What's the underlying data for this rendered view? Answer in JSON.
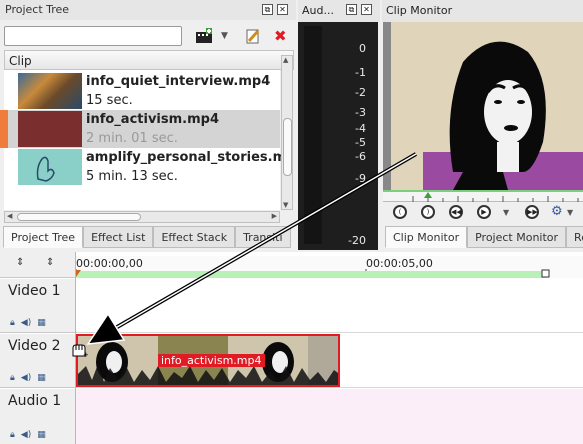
{
  "project_tree": {
    "title": "Project Tree",
    "column_header": "Clip",
    "clips": [
      {
        "name": "info_quiet_interview.mp4",
        "duration": "15 sec."
      },
      {
        "name": "info_activism.mp4",
        "duration": "2 min. 01 sec."
      },
      {
        "name": "amplify_personal_stories.m",
        "duration": "5 min. 13 sec."
      }
    ],
    "tabs": [
      "Project Tree",
      "Effect List",
      "Effect Stack",
      "Transiti"
    ]
  },
  "audio_meter": {
    "title": "Aud...",
    "ticks": [
      "0",
      "-1",
      "-2",
      "-3",
      "-4",
      "-5",
      "-6",
      "-9",
      "-20"
    ]
  },
  "clip_monitor": {
    "title": "Clip Monitor",
    "tabs": [
      "Clip Monitor",
      "Project Monitor",
      "Re"
    ]
  },
  "timeline": {
    "timecodes": [
      "00:00:00,00",
      "00:00:05,00"
    ],
    "tracks": [
      "Video 1",
      "Video 2",
      "Audio 1"
    ],
    "clip_label": "info_activism.mp4"
  },
  "colors": {
    "accent_red": "#e01b24",
    "selected_row": "#d4d4d4",
    "clip_marker": "#f07c3c",
    "audio_lane": "#fbeef8",
    "ruler_green": "#b8f0b8"
  }
}
